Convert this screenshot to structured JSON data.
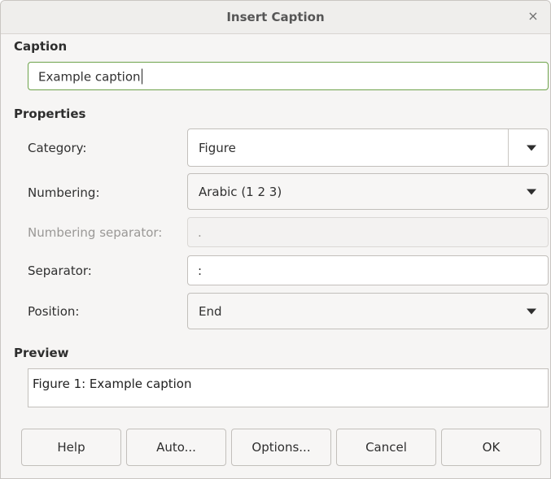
{
  "window": {
    "title": "Insert Caption",
    "close_glyph": "×"
  },
  "caption": {
    "section_label": "Caption",
    "value": "Example caption"
  },
  "properties": {
    "section_label": "Properties",
    "category": {
      "label": "Category:",
      "value": "Figure"
    },
    "numbering": {
      "label": "Numbering:",
      "value": "Arabic (1 2 3)"
    },
    "numbering_separator": {
      "label": "Numbering separator:",
      "value": "."
    },
    "separator": {
      "label": "Separator:",
      "value": ":"
    },
    "position": {
      "label": "Position:",
      "value": "End"
    }
  },
  "preview": {
    "section_label": "Preview",
    "text": "Figure 1: Example caption"
  },
  "buttons": {
    "help": "Help",
    "auto": "Auto...",
    "options": "Options...",
    "cancel": "Cancel",
    "ok": "OK"
  },
  "colors": {
    "focus_border": "#6ea34b",
    "dialog_background": "#f6f5f4"
  },
  "icons": {
    "close": "close-icon",
    "dropdown": "chevron-down-icon"
  }
}
